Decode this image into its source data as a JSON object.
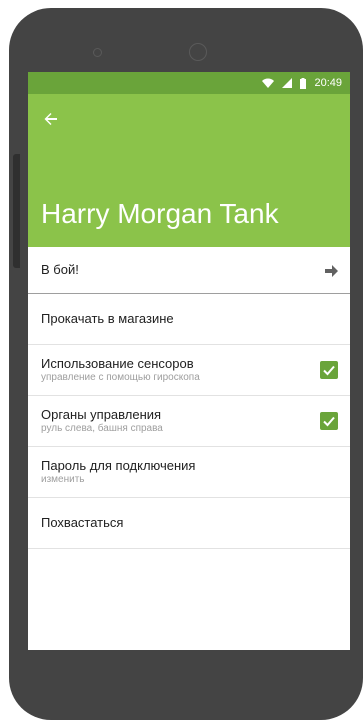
{
  "statusbar": {
    "time": "20:49",
    "icons": [
      "wifi-icon",
      "signal-icon",
      "battery-icon"
    ]
  },
  "appbar": {
    "back_icon": "arrow-left-icon",
    "title": "Harry Morgan Tank"
  },
  "list": {
    "fight": {
      "label": "В бой!",
      "icon": "arrow-right-icon"
    },
    "upgrade": {
      "label": "Прокачать в магазине"
    },
    "sensors": {
      "label": "Использование сенсоров",
      "sub": "управление с помощью гироскопа",
      "checked": true
    },
    "controls": {
      "label": "Органы управления",
      "sub": "руль слева, башня справа",
      "checked": true
    },
    "password": {
      "label": "Пароль для подключения",
      "sub": "изменить"
    },
    "brag": {
      "label": "Похвастаться"
    }
  },
  "colors": {
    "appbar": "#8bc34a",
    "statusbar": "#6aa43a",
    "checkbox": "#6aa43a",
    "device": "#444444"
  }
}
